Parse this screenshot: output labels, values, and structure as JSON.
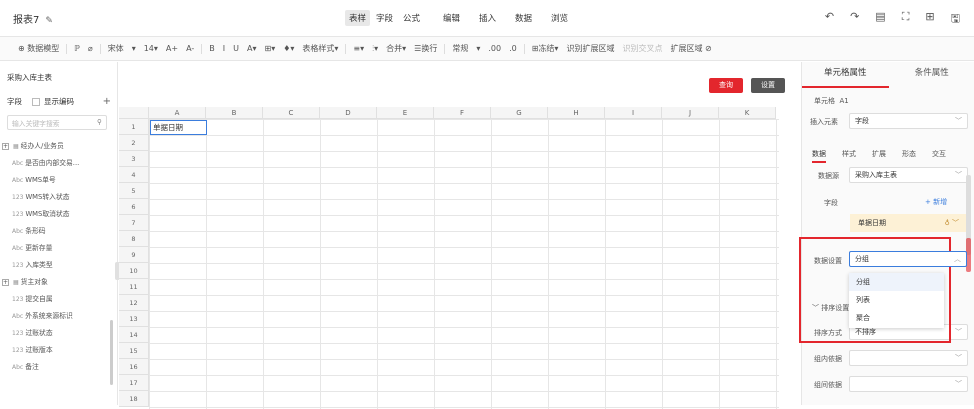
{
  "header": {
    "title": "报表7",
    "modes": [
      "表样",
      "字段",
      "公式"
    ],
    "actions": [
      "编辑",
      "插入",
      "数据",
      "浏览"
    ],
    "right_icons": [
      "↶",
      "↷",
      "▤",
      "⛶",
      "⊞",
      "🖫"
    ]
  },
  "toolbar": {
    "items": [
      "⊕ 数据模型",
      "ℙ",
      "⌀",
      "宋体",
      "▾",
      "14▾",
      "A+",
      "A-",
      "B",
      "I",
      "U",
      "A▾",
      "⊞▾",
      "♦▾",
      "表格样式▾",
      "≡▾",
      "⫶▾",
      "合并▾",
      "☰换行",
      "常规",
      "▾",
      ".00",
      ".0",
      "⊞冻结▾",
      "识别扩展区域",
      "识别交叉点",
      "扩展区域 ⊘"
    ]
  },
  "left": {
    "dataset": "采购入库主表",
    "field_label": "字段",
    "show_code": "显示编码",
    "search_placeholder": "输入关键字搜索",
    "fields": [
      {
        "type": "group",
        "label": "经办人/业务员"
      },
      {
        "type": "Abc",
        "label": "是否由内部交易..."
      },
      {
        "type": "Abc",
        "label": "WMS单号"
      },
      {
        "type": "123",
        "label": "WMS转入状态"
      },
      {
        "type": "123",
        "label": "WMS取消状态"
      },
      {
        "type": "Abc",
        "label": "条形码"
      },
      {
        "type": "Abc",
        "label": "更新存量"
      },
      {
        "type": "123",
        "label": "入库类型"
      },
      {
        "type": "group",
        "label": "货主对象"
      },
      {
        "type": "123",
        "label": "提交自属"
      },
      {
        "type": "Abc",
        "label": "外系统来源标识"
      },
      {
        "type": "123",
        "label": "过账状态"
      },
      {
        "type": "123",
        "label": "过账版本"
      },
      {
        "type": "Abc",
        "label": "备注"
      }
    ]
  },
  "center": {
    "query_label": "查询",
    "settings_label": "设置",
    "columns": [
      "A",
      "B",
      "C",
      "D",
      "E",
      "F",
      "G",
      "H",
      "I",
      "J",
      "K"
    ],
    "rows": [
      "1",
      "2",
      "3",
      "4",
      "5",
      "6",
      "7",
      "8",
      "9",
      "10",
      "11",
      "12",
      "13",
      "14",
      "15",
      "16",
      "17",
      "18"
    ],
    "cell_a1": "单据日期"
  },
  "right": {
    "tab_cell": "单元格属性",
    "tab_condition": "条件属性",
    "cell_label": "单元格",
    "cell_ref": "A1",
    "insert_label": "插入元素",
    "insert_value": "字段",
    "sub_tabs": [
      "数据",
      "样式",
      "扩展",
      "形态",
      "交互"
    ],
    "datasource_label": "数据源",
    "datasource_value": "采购入库主表",
    "field_label": "字段",
    "add_label": "+ 新增",
    "chip_label": "单据日期",
    "data_setting_label": "数据设置",
    "data_setting_value": "分组",
    "options": [
      "分组",
      "列表",
      "聚合"
    ],
    "sort_section": "排序设置",
    "sort_label": "排序方式",
    "sort_value": "不排序",
    "group_by_label": "组内依据",
    "group_by2_label": "组间依据"
  }
}
